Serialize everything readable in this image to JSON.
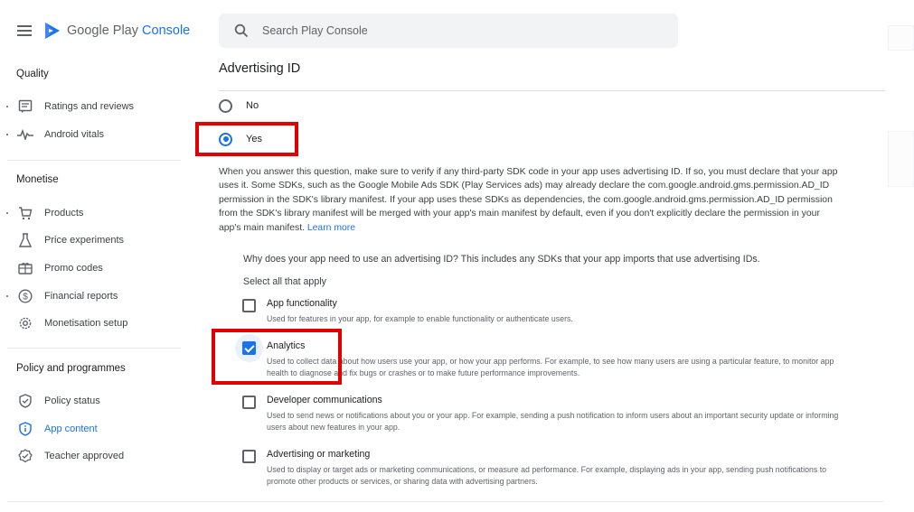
{
  "brand": {
    "name_part1": "Google Play",
    "name_part2": "Console"
  },
  "search": {
    "placeholder": "Search Play Console"
  },
  "sidebar": {
    "sections": [
      {
        "title": "Quality"
      },
      {
        "title": "Monetise"
      },
      {
        "title": "Policy and programmes"
      }
    ],
    "items": [
      {
        "label": "Ratings and reviews",
        "icon": "ratings-icon"
      },
      {
        "label": "Android vitals",
        "icon": "vitals-icon"
      },
      {
        "label": "Products",
        "icon": "cart-icon"
      },
      {
        "label": "Price experiments",
        "icon": "flask-icon"
      },
      {
        "label": "Promo codes",
        "icon": "promo-icon"
      },
      {
        "label": "Financial reports",
        "icon": "dollar-icon"
      },
      {
        "label": "Monetisation setup",
        "icon": "gear-icon"
      },
      {
        "label": "Policy status",
        "icon": "shield-icon"
      },
      {
        "label": "App content",
        "icon": "shield-info-icon",
        "active": true
      },
      {
        "label": "Teacher approved",
        "icon": "badge-icon"
      }
    ]
  },
  "main": {
    "title": "Advertising ID",
    "radio_options": [
      {
        "label": "No",
        "checked": false
      },
      {
        "label": "Yes",
        "checked": true
      }
    ],
    "paragraph": "When you answer this question, make sure to verify if any third-party SDK code in your app uses advertising ID. If so, you must declare that your app uses it. Some SDKs, such as the Google Mobile Ads SDK (Play Services ads) may already declare the com.google.android.gms.permission.AD_ID permission in the SDK's library manifest. If your app uses these SDKs as dependencies, the com.google.android.gms.permission.AD_ID permission from the SDK's library manifest will be merged with your app's main manifest by default, even if you don't explicitly declare the permission in your app's main manifest.",
    "learn_more": "Learn more",
    "question": "Why does your app need to use an advertising ID? This includes any SDKs that your app imports that use advertising IDs.",
    "select_all": "Select all that apply",
    "checkboxes": [
      {
        "title": "App functionality",
        "desc": "Used for features in your app, for example to enable functionality or authenticate users.",
        "checked": false
      },
      {
        "title": "Analytics",
        "desc": "Used to collect data about how users use your app, or how your app performs. For example, to see how many users are using a particular feature, to monitor app health to diagnose and fix bugs or crashes or to make future performance improvements.",
        "checked": true
      },
      {
        "title": "Developer communications",
        "desc": "Used to send news or notifications about you or your app. For example, sending a push notification to inform users about an important security update or informing users about new features in your app.",
        "checked": false
      },
      {
        "title": "Advertising or marketing",
        "desc": "Used to display or target ads or marketing communications, or measure ad performance. For example, displaying ads in your app, sending push notifications to promote other products or services, or sharing data with advertising partners.",
        "checked": false
      }
    ]
  },
  "colors": {
    "accent": "#1a73e8",
    "highlight": "#e00000"
  }
}
